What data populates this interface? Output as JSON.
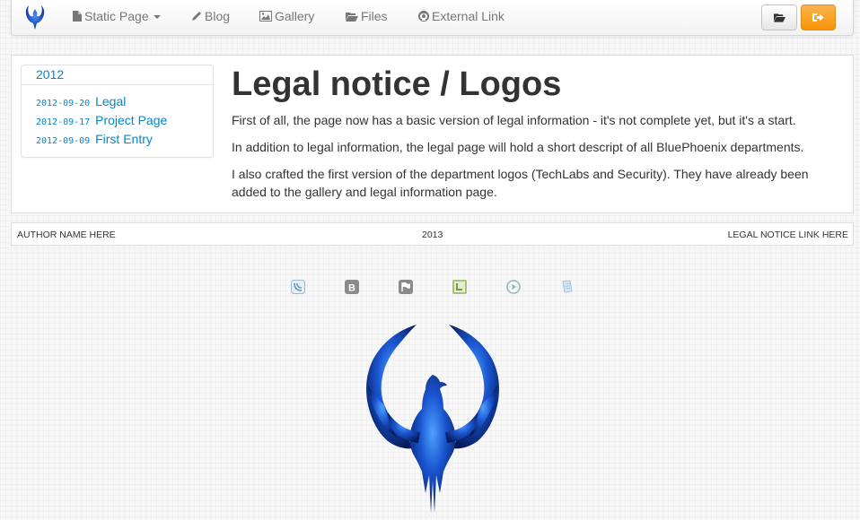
{
  "navbar": {
    "brand_icon": "phoenix-logo-icon",
    "items": [
      {
        "label": "Static Page",
        "icon": "file-icon",
        "has_caret": true
      },
      {
        "label": "Blog",
        "icon": "pencil-icon"
      },
      {
        "label": "Gallery",
        "icon": "picture-icon"
      },
      {
        "label": "Files",
        "icon": "folder-open-icon"
      },
      {
        "label": "External Link",
        "icon": "github-icon"
      }
    ],
    "right_buttons": [
      {
        "icon": "folder-open-icon",
        "color": "#f5f5f5"
      },
      {
        "icon": "sign-out-icon",
        "color": "#f89406"
      }
    ]
  },
  "sidebar": {
    "year": "2012",
    "entries": [
      {
        "date": "2012-09-20",
        "title": "Legal"
      },
      {
        "date": "2012-09-17",
        "title": "Project Page"
      },
      {
        "date": "2012-09-09",
        "title": "First Entry"
      }
    ]
  },
  "article": {
    "title": "Legal notice / Logos",
    "paragraphs": [
      "First of all, the page now has a basic version of legal information - it's not complete yet, but it's a start.",
      "In addition to legal information, the legal page will hold a short descript of all BluePhoenix departments.",
      "I also crafted the first version of the department logos (TechLabs and Security). They have already been added to the gallery and legal information page."
    ]
  },
  "footer": {
    "left": "AUTHOR NAME HERE",
    "center": "2013",
    "right": "LEGAL NOTICE LINK HERE"
  },
  "badges": [
    {
      "icon": "wave-badge-icon",
      "color": "#7aa6c2"
    },
    {
      "icon": "b-badge-icon",
      "color": "#8a8a8a"
    },
    {
      "icon": "flag-badge-icon",
      "color": "#8a8a8a"
    },
    {
      "icon": "l-badge-icon",
      "color": "#9cb86a"
    },
    {
      "icon": "play-badge-icon",
      "color": "#8fb5b5"
    },
    {
      "icon": "document-badge-icon",
      "color": "#9cc3e0"
    }
  ],
  "colors": {
    "link": "#0088cc",
    "accent_orange": "#f89406",
    "phoenix_blue": "#1f5fd6"
  }
}
